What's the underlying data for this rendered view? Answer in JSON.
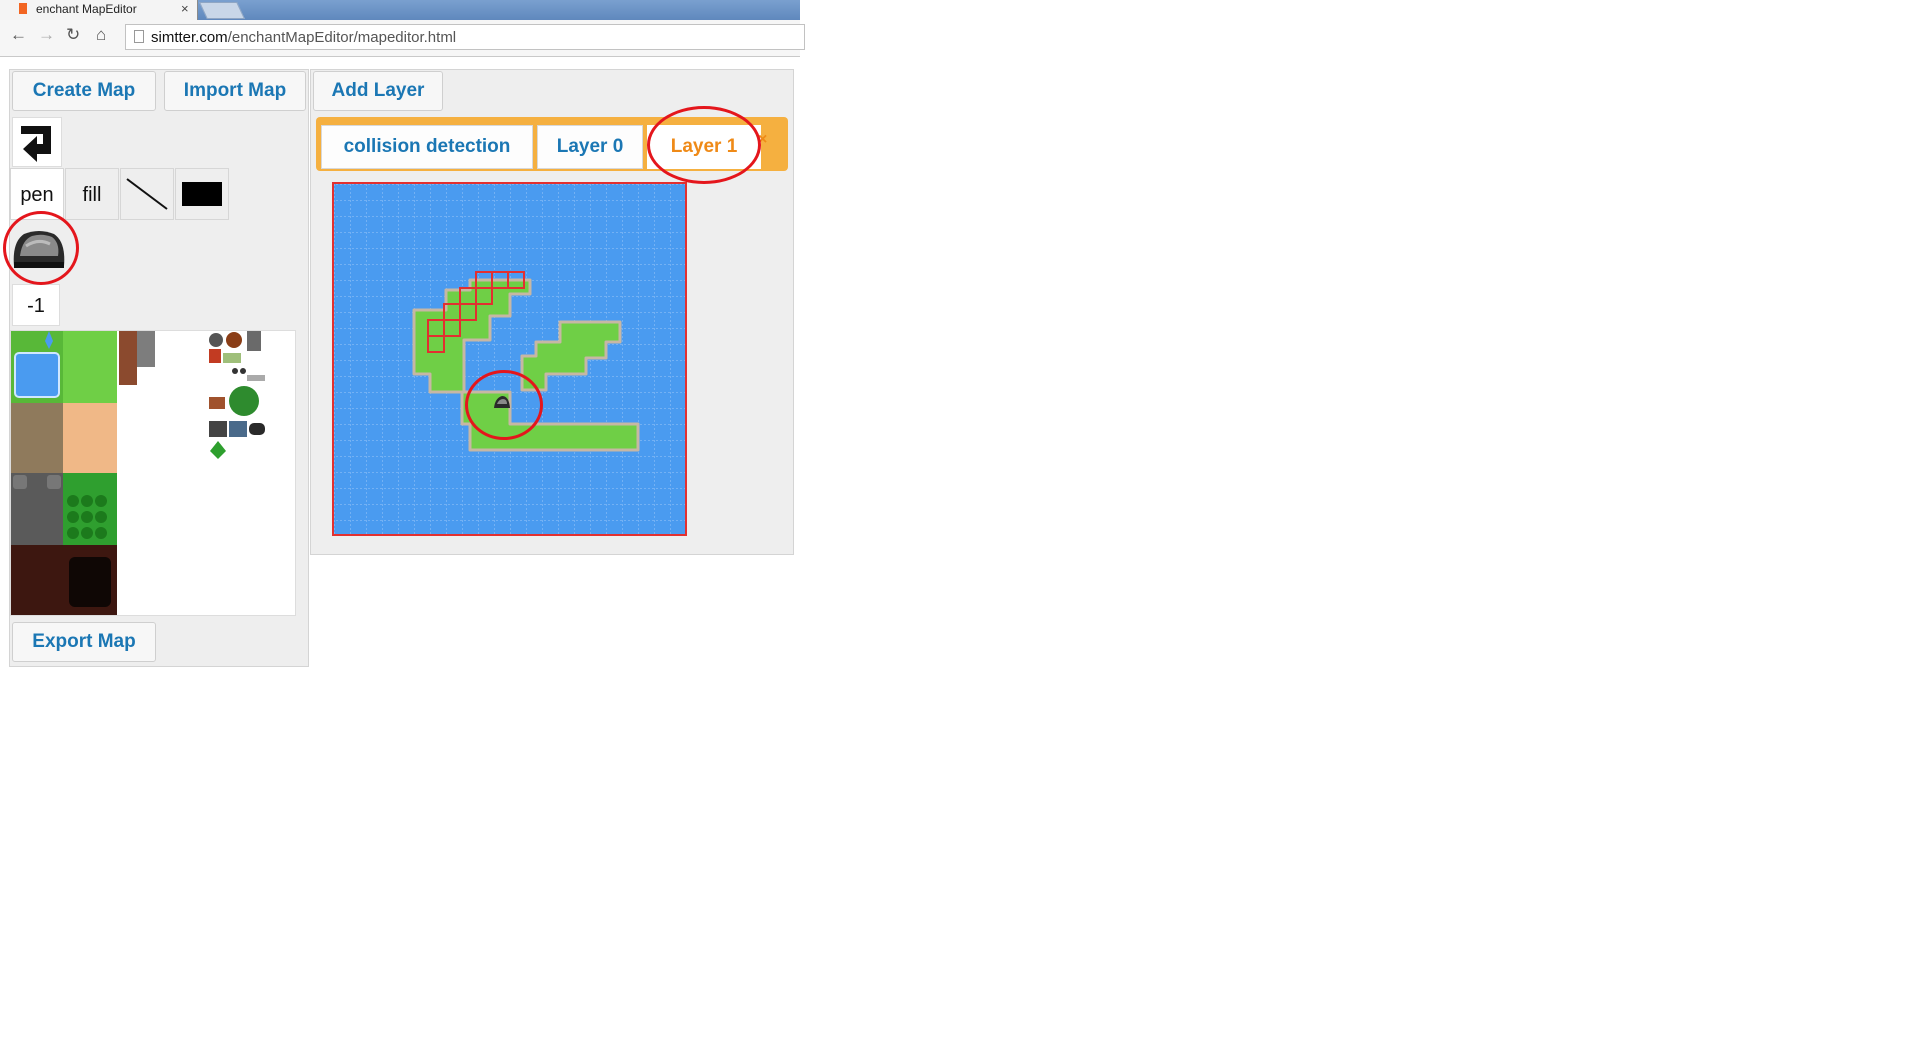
{
  "browser": {
    "tab_title": "enchant MapEditor",
    "tab_close": "×",
    "url_host": "simtter.com",
    "url_path": "/enchantMapEditor/mapeditor.html"
  },
  "toolbar": {
    "create_map": "Create Map",
    "import_map": "Import Map",
    "add_layer": "Add Layer",
    "export_map": "Export Map"
  },
  "tools": {
    "pen": "pen",
    "fill": "fill",
    "line_icon": "line-icon",
    "rect_icon": "rectangle-icon",
    "undo_icon": "undo-arrow-icon",
    "active": "pen"
  },
  "selected_tile": {
    "icon": "rock-tile-icon",
    "layer_value": "-1"
  },
  "layers": {
    "tabs": [
      "collision detection",
      "Layer 0",
      "Layer 1"
    ],
    "selected": "Layer 1",
    "close": "×"
  },
  "colors": {
    "accent_blue": "#1b77b4",
    "accent_orange": "#ef8a17",
    "tab_strip": "#f5b040",
    "water": "#4a9bf0",
    "grass": "#6fcf46",
    "annotation_red": "#e4161c"
  }
}
